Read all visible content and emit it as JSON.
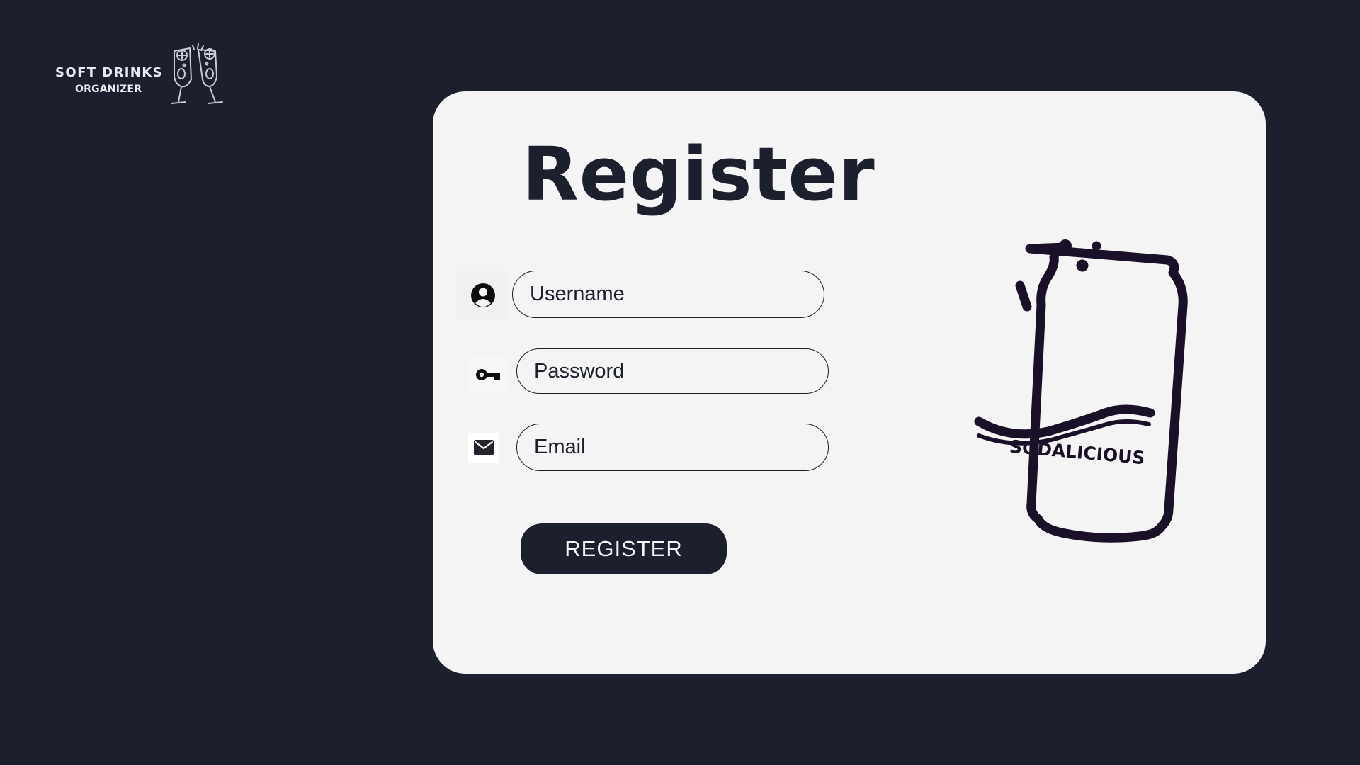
{
  "logo": {
    "title": "SOFT DRINKS",
    "subtitle": "ORGANIZER",
    "icon": "clinking-glasses-icon"
  },
  "form": {
    "heading": "Register",
    "username": {
      "placeholder": "Username",
      "value": "",
      "icon": "user-circle-icon"
    },
    "password": {
      "placeholder": "Password",
      "value": "",
      "icon": "key-icon"
    },
    "email": {
      "placeholder": "Email",
      "value": "",
      "icon": "envelope-icon"
    },
    "submit_label": "REGISTER"
  },
  "illustration": {
    "label": "SODALICIOUS",
    "icon": "soda-can-icon"
  },
  "colors": {
    "background": "#1b1f2e",
    "card": "#f4f4f4",
    "accent": "#1b1f2e"
  }
}
